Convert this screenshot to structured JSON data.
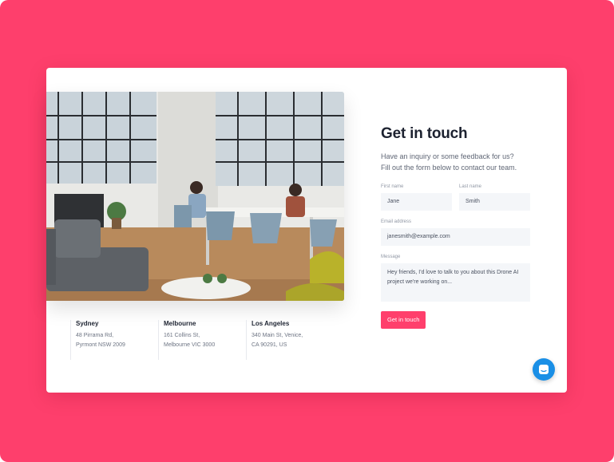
{
  "colors": {
    "background": "#fe3f6c",
    "card": "#ffffff",
    "accent": "#ff3f6c",
    "chat": "#1a8fe6"
  },
  "photo": {
    "alt": "Office with two people working at a table"
  },
  "locations": [
    {
      "city": "Sydney",
      "line1": "48 Pirrama Rd,",
      "line2": "Pyrmont NSW 2009"
    },
    {
      "city": "Melbourne",
      "line1": "161 Collins St,",
      "line2": "Melbourne VIC 3000"
    },
    {
      "city": "Los Angeles",
      "line1": "340 Main St, Venice,",
      "line2": "CA 90291, US"
    }
  ],
  "form": {
    "title": "Get in touch",
    "subtitle_line1": "Have an inquiry or some feedback for us?",
    "subtitle_line2": "Fill out the form below to contact our team.",
    "first_name": {
      "label": "First name",
      "value": "Jane"
    },
    "last_name": {
      "label": "Last name",
      "value": "Smith"
    },
    "email": {
      "label": "Email address",
      "value": "janesmith@example.com"
    },
    "message": {
      "label": "Message",
      "value": "Hey friends, I'd love to talk to you about this Drone AI project we're working on..."
    },
    "submit_label": "Get in touch"
  },
  "chat": {
    "icon": "chat-icon"
  }
}
